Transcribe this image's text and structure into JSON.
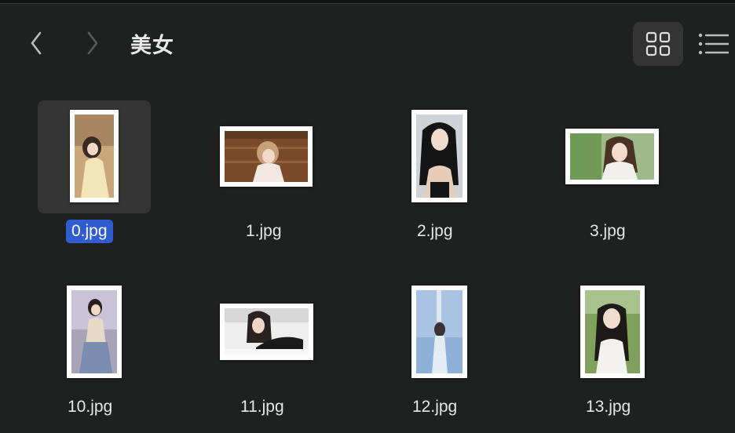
{
  "window": {
    "title": "美女"
  },
  "toolbar": {
    "back_icon": "chevron-left-icon",
    "forward_icon": "chevron-right-icon",
    "grid_view_icon": "grid-view-icon",
    "list_view_icon": "list-view-icon"
  },
  "files": [
    {
      "name": "0.jpg",
      "selected": true
    },
    {
      "name": "1.jpg",
      "selected": false
    },
    {
      "name": "2.jpg",
      "selected": false
    },
    {
      "name": "3.jpg",
      "selected": false
    },
    {
      "name": "10.jpg",
      "selected": false
    },
    {
      "name": "11.jpg",
      "selected": false
    },
    {
      "name": "12.jpg",
      "selected": false
    },
    {
      "name": "13.jpg",
      "selected": false
    }
  ],
  "colors": {
    "background": "#1f2020",
    "selection": "#2f5ccf",
    "selected_tile": "#353535",
    "active_view_button": "#343434"
  }
}
